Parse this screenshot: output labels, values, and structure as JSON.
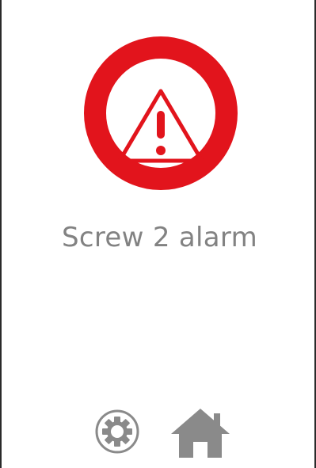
{
  "screen": {
    "alarm_message": "Screw 2 alarm"
  },
  "icons": {
    "alarm": "warning-triangle-icon",
    "settings": "gear-icon",
    "home": "home-icon"
  },
  "colors": {
    "alarm_red": "#e2141c",
    "text_gray": "#828282",
    "icon_gray": "#8a8a8a"
  }
}
